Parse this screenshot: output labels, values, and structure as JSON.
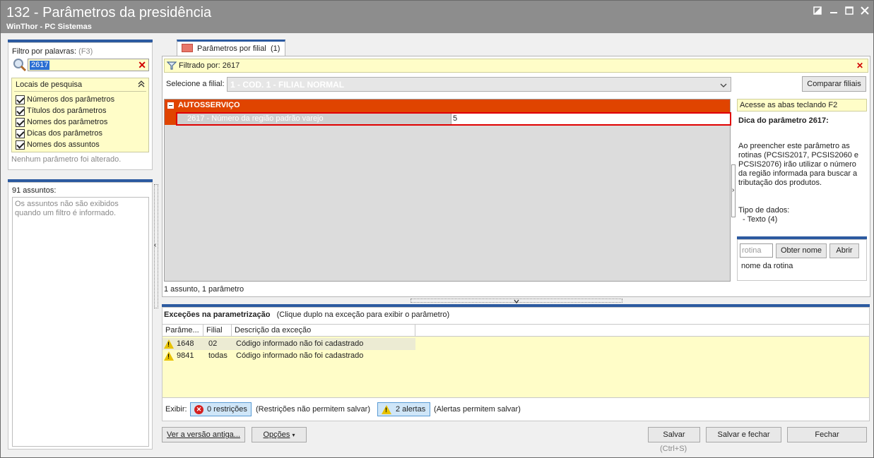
{
  "window": {
    "title": "132 - Parâmetros da presidência",
    "subtitle": "WinThor - PC Sistemas"
  },
  "left": {
    "filter_label": "Filtro por palavras:",
    "filter_shortcut": "(F3)",
    "search_value": "2617",
    "locais_title": "Locais de pesquisa",
    "checkboxes": [
      {
        "label": "Números dos parâmetros",
        "checked": true
      },
      {
        "label": "Títulos dos parâmetros",
        "checked": true
      },
      {
        "label": "Nomes dos parâmetros",
        "checked": true
      },
      {
        "label": "Dicas dos parâmetros",
        "checked": true
      },
      {
        "label": "Nomes dos assuntos",
        "checked": true
      }
    ],
    "status": "Nenhum parâmetro foi alterado.",
    "assuntos_count": "91 assuntos:",
    "assuntos_note": "Os assuntos não são exibidos quando um filtro é informado."
  },
  "main": {
    "tab_label": "Parâmetros por filial",
    "tab_count": "(1)",
    "filter_text": "Filtrado por: 2617",
    "filial_label": "Selecione a filial:",
    "filial_value": "1 - COD. 1 - FILIAL NORMAL",
    "compare_button": "Comparar filiais",
    "group_title": "AUTOSSERVIÇO",
    "param_name": "2617 - Número da região padrão varejo",
    "param_value": "5",
    "summary": "1 assunto, 1 parâmetro"
  },
  "right": {
    "hint": "Acesse as abas teclando F2",
    "dica_title": "Dica do parâmetro 2617:",
    "dica_text": "Ao preencher este parâmetro as rotinas (PCSIS2017, PCSIS2060 e PCSIS2076) irão utilizar o número da região informada para buscar a tributação dos produtos.",
    "tipo_label": "Tipo de dados:",
    "tipo_value": "- Texto (4)",
    "rotina_placeholder": "rotina",
    "obter_button": "Obter nome",
    "abrir_button": "Abrir",
    "rotina_name_label": "nome da rotina"
  },
  "exceptions": {
    "title": "Exceções na parametrização",
    "subtitle": "(Clique duplo na exceção para exibir o parâmetro)",
    "columns": [
      "Parâme...",
      "Filial",
      "Descrição da exceção"
    ],
    "rows": [
      {
        "param": "1648",
        "filial": "02",
        "desc": "Código informado não foi cadastrado"
      },
      {
        "param": "9841",
        "filial": "todas",
        "desc": "Código informado não foi cadastrado"
      }
    ],
    "exibir_label": "Exibir:",
    "restricoes_badge": "0 restrições",
    "restricoes_note": "(Restrições não permitem salvar)",
    "alertas_badge": "2 alertas",
    "alertas_note": "(Alertas permitem salvar)"
  },
  "footer": {
    "versao_button": "Ver a versão antiga...",
    "opcoes_button": "Opções",
    "salvar_button": "Salvar",
    "salvar_shortcut": "(Ctrl+S)",
    "salvar_fechar_button": "Salvar e fechar",
    "fechar_button": "Fechar"
  },
  "colors": {
    "accent_blue": "#2c5aa0",
    "group_orange": "#e04400",
    "highlight_yellow": "#fffdc8",
    "error_red": "#d42020"
  }
}
